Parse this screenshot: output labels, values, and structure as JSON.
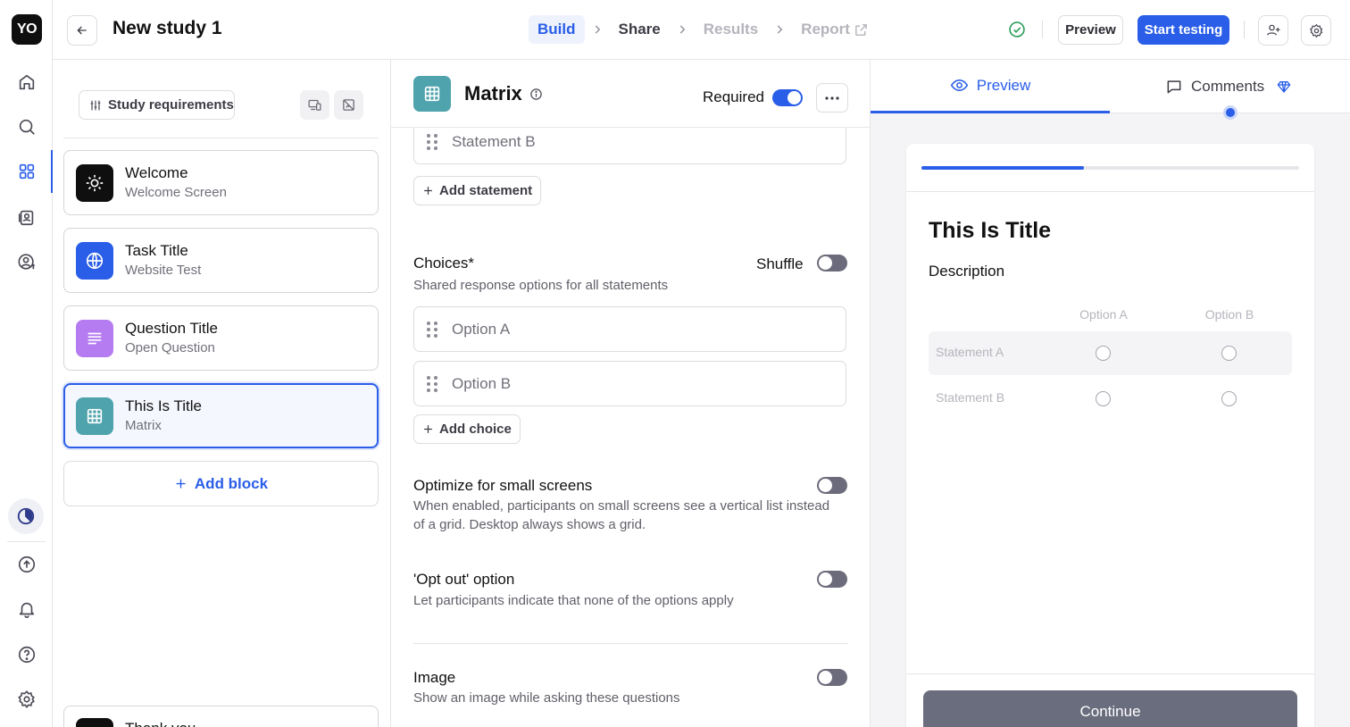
{
  "app": {
    "logo": "YO"
  },
  "rail": {
    "icons": [
      "home-icon",
      "search-icon",
      "grid-icon",
      "contacts-icon",
      "user-dollar-icon",
      "clock-icon",
      "upload-icon",
      "bell-icon",
      "help-icon",
      "gear-icon"
    ]
  },
  "header": {
    "title": "New study 1",
    "steps": [
      {
        "label": "Build",
        "state": "active"
      },
      {
        "label": "Share",
        "state": "normal"
      },
      {
        "label": "Results",
        "state": "disabled"
      },
      {
        "label": "Report",
        "state": "disabled"
      }
    ],
    "preview_label": "Preview",
    "start_label": "Start testing"
  },
  "blocks": {
    "requirements_label": "Study requirements",
    "items": [
      {
        "title": "Welcome",
        "subtitle": "Welcome Screen",
        "icon": "sun-icon",
        "color": "#0f0f10"
      },
      {
        "title": "Task Title",
        "subtitle": "Website Test",
        "icon": "globe-icon",
        "color": "#2a5ee8"
      },
      {
        "title": "Question Title",
        "subtitle": "Open Question",
        "icon": "lines-icon",
        "color": "#b57bf0"
      },
      {
        "title": "This Is Title",
        "subtitle": "Matrix",
        "icon": "matrix-icon",
        "color": "#4fa3ac"
      }
    ],
    "add_block_label": "Add block",
    "thanks_title": "Thank you"
  },
  "editor": {
    "title": "Matrix",
    "required_label": "Required",
    "required_on": true,
    "statement_b": "Statement B",
    "add_statement_label": "Add statement",
    "choices_title": "Choices*",
    "choices_desc": "Shared response options for all statements",
    "shuffle_label": "Shuffle",
    "shuffle_on": false,
    "options": [
      "Option A",
      "Option B"
    ],
    "add_choice_label": "Add choice",
    "small_screens_title": "Optimize for small screens",
    "small_screens_desc": "When enabled, participants on small screens see a vertical list instead of a grid. Desktop always shows a grid.",
    "optout_title": "'Opt out' option",
    "optout_desc": "Let participants indicate that none of the options apply",
    "image_title": "Image",
    "image_desc": "Show an image while asking these questions"
  },
  "preview": {
    "tab_preview": "Preview",
    "tab_comments": "Comments",
    "progress_fraction": 0.43,
    "title": "This Is Title",
    "description": "Description",
    "columns": [
      "Option A",
      "Option B"
    ],
    "rows": [
      "Statement A",
      "Statement B"
    ],
    "continue_label": "Continue"
  },
  "colors": {
    "accent": "#2a5ee8",
    "matrix": "#4fa3ac",
    "success": "#2e9e5b"
  }
}
